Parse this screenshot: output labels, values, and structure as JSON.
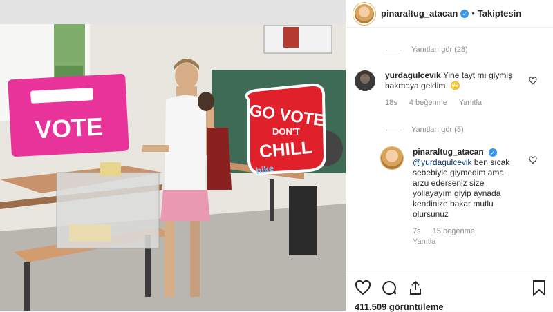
{
  "post": {
    "stickers": {
      "vote_label": "VOTE",
      "go_vote_line1": "GO VOTE",
      "go_vote_line2": "DON'T",
      "go_vote_line3": "CHILL",
      "hike_label": "hike"
    }
  },
  "header": {
    "username": "pinaraltug_atacan",
    "separator": "•",
    "follow_label": "Takiptesin"
  },
  "comments": {
    "view_replies_1": "Yanıtları gör (28)",
    "view_replies_2": "Yanıtları gör (5)",
    "items": [
      {
        "username": "yurdagulcevik",
        "text": "Yine tayt mı giymiş bakmaya geldim. 🙄",
        "time": "18s",
        "likes": "4 beğenme",
        "reply_label": "Yanıtla"
      },
      {
        "username": "pinaraltug_atacan",
        "mention": "@yurdagulcevik",
        "text": "ben sıcak sebebiyle giymedim ama arzu ederseniz size yollayayım giyip aynada kendinize bakar mutlu olursunuz",
        "time": "7s",
        "likes": "15 beğenme",
        "reply_label": "Yanıtla"
      }
    ]
  },
  "footer": {
    "views": "411.509 görüntüleme"
  },
  "colors": {
    "accent": "#3897f0",
    "sticker_pink": "#e8339a",
    "sticker_red": "#e0202a"
  }
}
